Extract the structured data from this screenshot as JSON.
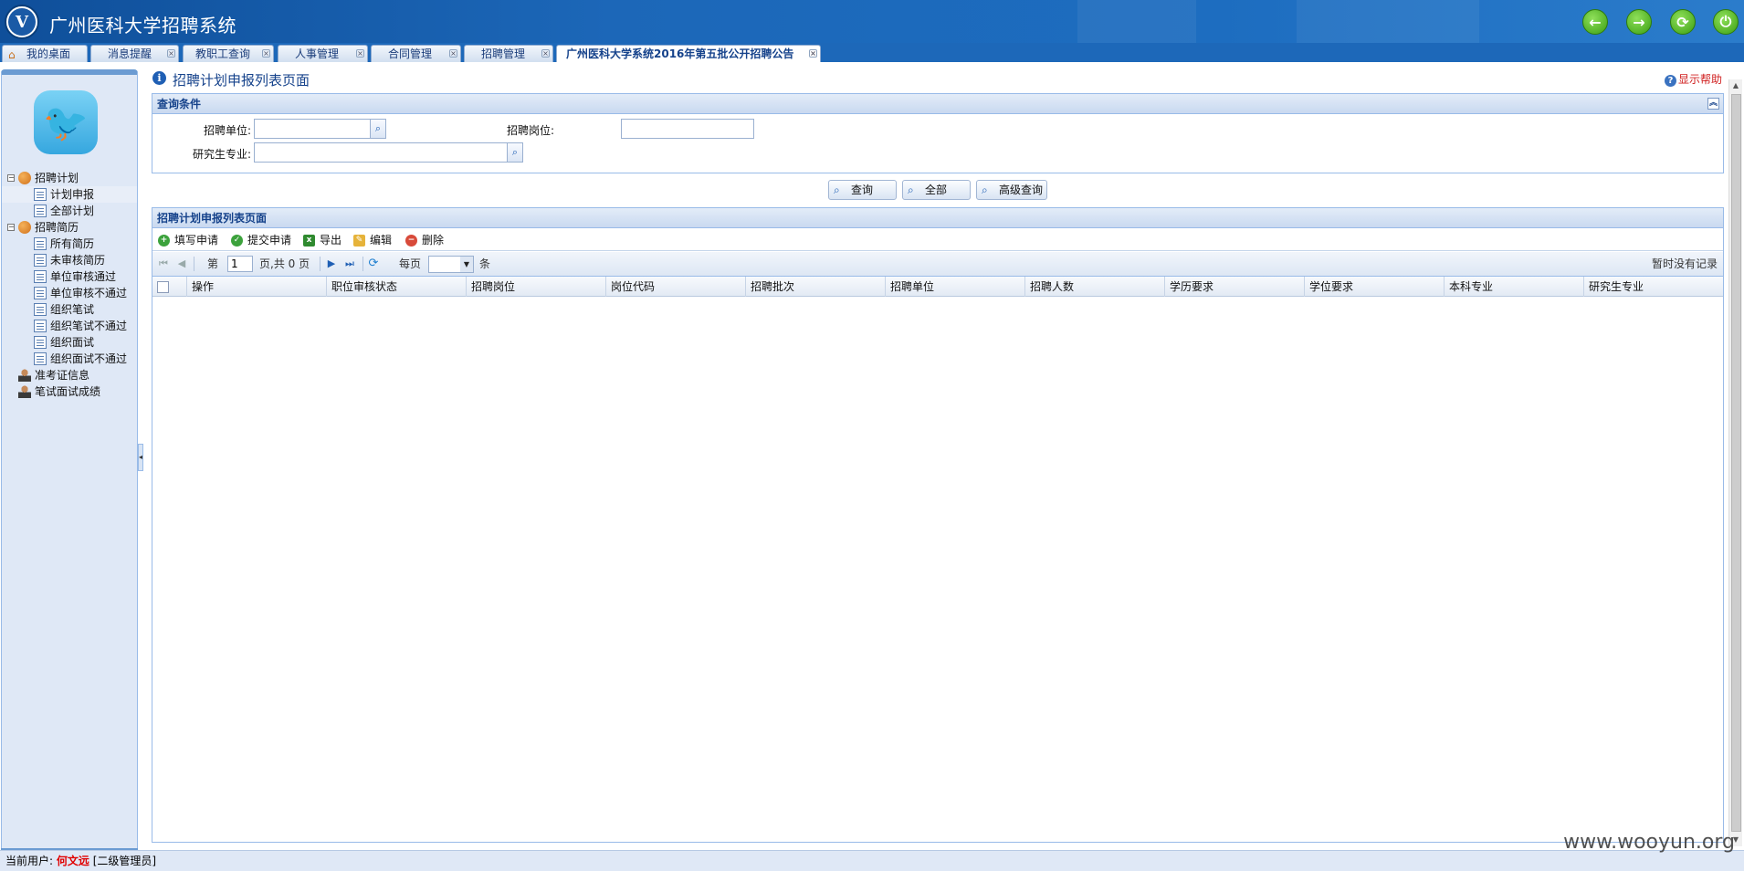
{
  "header": {
    "app_title": "广州医科大学招聘系统",
    "logo_text": "V",
    "buttons": [
      {
        "name": "back-icon",
        "glyph": "←"
      },
      {
        "name": "forward-icon",
        "glyph": "→"
      },
      {
        "name": "refresh-icon",
        "glyph": "⟳"
      },
      {
        "name": "power-icon",
        "glyph": "⏻"
      }
    ]
  },
  "tabs": [
    {
      "label": "我的桌面",
      "closable": false,
      "active": false
    },
    {
      "label": "消息提醒",
      "closable": true,
      "active": false
    },
    {
      "label": "教职工查询",
      "closable": true,
      "active": false
    },
    {
      "label": "人事管理",
      "closable": true,
      "active": false
    },
    {
      "label": "合同管理",
      "closable": true,
      "active": false
    },
    {
      "label": "招聘管理",
      "closable": true,
      "active": false
    },
    {
      "label": "广州医科大学系统2016年第五批公开招聘公告",
      "closable": true,
      "active": true
    }
  ],
  "sidebar": {
    "tree": [
      {
        "label": "招聘计划",
        "level": 0,
        "icon": "group-icon",
        "expandable": true
      },
      {
        "label": "计划申报",
        "level": 1,
        "icon": "document-icon",
        "selected": true
      },
      {
        "label": "全部计划",
        "level": 1,
        "icon": "document-icon"
      },
      {
        "label": "招聘简历",
        "level": 0,
        "icon": "group-icon",
        "expandable": true
      },
      {
        "label": "所有简历",
        "level": 1,
        "icon": "document-icon"
      },
      {
        "label": "未审核简历",
        "level": 1,
        "icon": "document-icon"
      },
      {
        "label": "单位审核通过",
        "level": 1,
        "icon": "document-icon"
      },
      {
        "label": "单位审核不通过",
        "level": 1,
        "icon": "document-icon"
      },
      {
        "label": "组织笔试",
        "level": 1,
        "icon": "document-icon"
      },
      {
        "label": "组织笔试不通过",
        "level": 1,
        "icon": "document-icon"
      },
      {
        "label": "组织面试",
        "level": 1,
        "icon": "document-icon"
      },
      {
        "label": "组织面试不通过",
        "level": 1,
        "icon": "document-icon"
      },
      {
        "label": "准考证信息",
        "level": 0,
        "icon": "user-icon"
      },
      {
        "label": "笔试面试成绩",
        "level": 0,
        "icon": "user-icon"
      }
    ]
  },
  "main": {
    "page_title": "招聘计划申报列表页面",
    "help_label": "显示帮助",
    "query_panel": {
      "title": "查询条件",
      "unit_label": "招聘单位:",
      "unit_value": "",
      "position_label": "招聘岗位:",
      "position_value": "",
      "major_label": "研究生专业:",
      "major_value": ""
    },
    "query_buttons": {
      "search": "查询",
      "all": "全部",
      "advanced": "高级查询"
    },
    "list_panel": {
      "title": "招聘计划申报列表页面",
      "toolbar": {
        "fill": "填写申请",
        "submit": "提交申请",
        "export": "导出",
        "edit": "编辑",
        "delete": "删除"
      },
      "pager": {
        "page_prefix": "第",
        "page_value": "1",
        "page_suffix": "页,共 0 页",
        "per_page_label": "每页",
        "per_page_value": "",
        "per_page_unit": "条",
        "status": "暂时没有记录"
      },
      "columns": [
        "操作",
        "职位审核状态",
        "招聘岗位",
        "岗位代码",
        "招聘批次",
        "招聘单位",
        "招聘人数",
        "学历要求",
        "学位要求",
        "本科专业",
        "研究生专业"
      ]
    }
  },
  "status_bar": {
    "label": "当前用户:",
    "user": "何文远",
    "role": "[二级管理员]"
  },
  "watermark": "www.wooyun.org",
  "colors": {
    "header": "#1c67b8",
    "panel_border": "#99bbe8",
    "title_text": "#15428b",
    "help_text": "#d02020",
    "user_text": "#e00000"
  }
}
